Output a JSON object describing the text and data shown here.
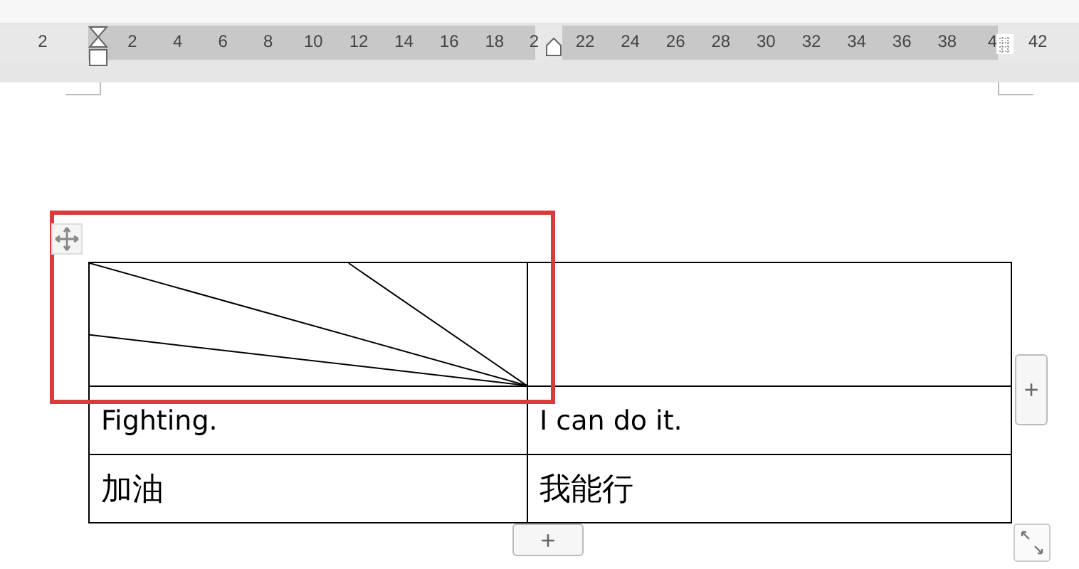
{
  "ruler": {
    "left_label": "2",
    "labels": [
      "2",
      "4",
      "6",
      "8",
      "10",
      "12",
      "14",
      "16",
      "18",
      "2",
      "22",
      "24",
      "26",
      "28",
      "30",
      "32",
      "34",
      "36",
      "38",
      "4",
      "42"
    ]
  },
  "table": {
    "rows": [
      {
        "cells": [
          {
            "kind": "diagonal"
          },
          {
            "kind": "empty"
          }
        ]
      },
      {
        "cells": [
          {
            "kind": "text",
            "text": "Fighting."
          },
          {
            "kind": "text",
            "text": "I can do it."
          }
        ]
      },
      {
        "cells": [
          {
            "kind": "text",
            "text": "加油"
          },
          {
            "kind": "text",
            "text": "我能行"
          }
        ]
      }
    ]
  },
  "add_column_button": "+",
  "add_row_button": "+"
}
